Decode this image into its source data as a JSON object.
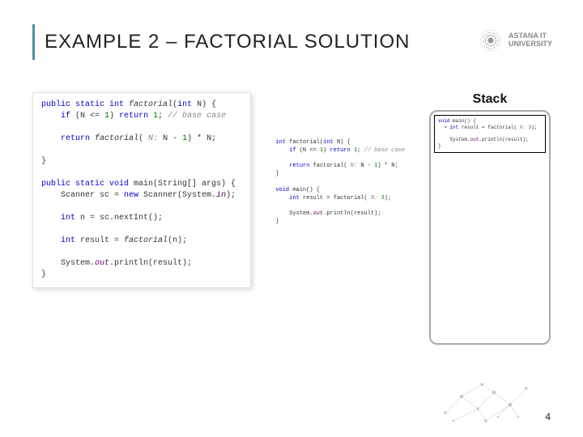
{
  "title": "EXAMPLE 2 – FACTORIAL SOLUTION",
  "logo": {
    "line1": "ASTANA IT",
    "line2": "UNIVERSITY"
  },
  "code_left": "public static int factorial(int N) {\n    if (N <= 1) return 1; // base case\n\n    return factorial( N: N - 1) * N;\n\n}\n\npublic static void main(String[] args) {\n    Scanner sc = new Scanner(System.in);\n\n    int n = sc.nextInt();\n\n    int result = factorial(n);\n\n    System.out.println(result);\n}",
  "code_mid": "int factorial(int N) {\n    if (N <= 1) return 1; // base case\n\n    return factorial( N: N - 1) * N;\n}\n\nvoid main() {\n    int result = factorial( N: 3);\n\n    System.out.println(result);\n}",
  "stack_title": "Stack",
  "stack_frame": "void main() {\n  > int result = factorial( N: 3);\n\n    System.out.println(result);\n}",
  "page": "4"
}
